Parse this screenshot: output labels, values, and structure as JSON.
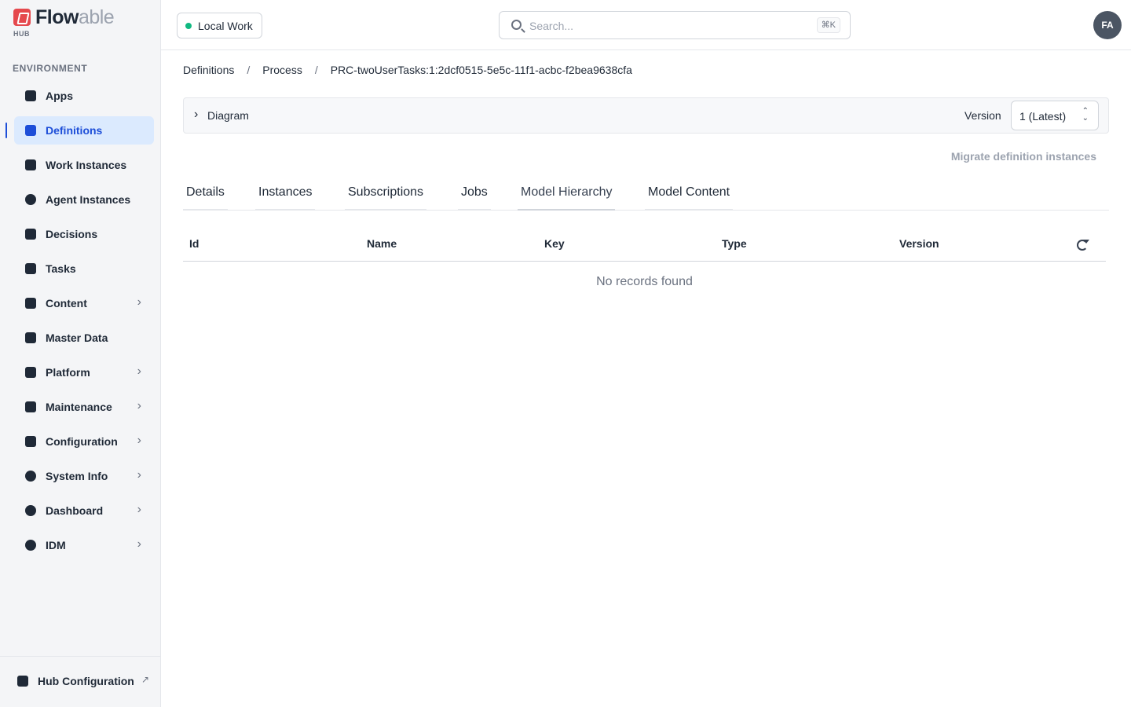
{
  "brand": {
    "name_bold": "Flow",
    "name_light": "able",
    "sub": "HUB"
  },
  "sidebar": {
    "section_label": "ENVIRONMENT",
    "items": [
      {
        "label": "Apps",
        "icon": "apps-icon",
        "chevron": false,
        "active": false
      },
      {
        "label": "Definitions",
        "icon": "definitions-icon",
        "chevron": false,
        "active": true
      },
      {
        "label": "Work Instances",
        "icon": "inbox-icon",
        "chevron": false,
        "active": false
      },
      {
        "label": "Agent Instances",
        "icon": "agent-icon",
        "chevron": false,
        "active": false
      },
      {
        "label": "Decisions",
        "icon": "table-icon",
        "chevron": false,
        "active": false
      },
      {
        "label": "Tasks",
        "icon": "clipboard-check-icon",
        "chevron": false,
        "active": false
      },
      {
        "label": "Content",
        "icon": "file-icon",
        "chevron": true,
        "active": false
      },
      {
        "label": "Master Data",
        "icon": "file-lock-icon",
        "chevron": false,
        "active": false
      },
      {
        "label": "Platform",
        "icon": "cube-icon",
        "chevron": true,
        "active": false
      },
      {
        "label": "Maintenance",
        "icon": "tools-icon",
        "chevron": true,
        "active": false
      },
      {
        "label": "Configuration",
        "icon": "key-icon",
        "chevron": true,
        "active": false
      },
      {
        "label": "System Info",
        "icon": "globe-icon",
        "chevron": true,
        "active": false
      },
      {
        "label": "Dashboard",
        "icon": "pie-chart-icon",
        "chevron": true,
        "active": false
      },
      {
        "label": "IDM",
        "icon": "users-icon",
        "chevron": true,
        "active": false
      }
    ],
    "footer": {
      "label": "Hub Configuration",
      "ext": "↗"
    }
  },
  "topbar": {
    "environment": "Local Work",
    "environment_status_color": "#10b981",
    "search_placeholder": "Search...",
    "shortcut": "⌘K",
    "avatar_initials": "FA"
  },
  "breadcrumb": {
    "items": [
      "Definitions",
      "Process",
      "PRC-twoUserTasks:1:2dcf0515-5e5c-11f1-acbc-f2bea9638cfa"
    ],
    "separator": "/"
  },
  "diagram": {
    "label": "Diagram",
    "version_label": "Version",
    "version_value": "1 (Latest)"
  },
  "migrate_label": "Migrate definition instances",
  "tabs": [
    {
      "label": "Details",
      "active": false
    },
    {
      "label": "Instances",
      "active": false
    },
    {
      "label": "Subscriptions",
      "active": false
    },
    {
      "label": "Jobs",
      "active": false
    },
    {
      "label": "Model Hierarchy",
      "active": true
    },
    {
      "label": "Model Content",
      "active": false
    }
  ],
  "table": {
    "columns": [
      "Id",
      "Name",
      "Key",
      "Type",
      "Version"
    ],
    "empty_text": "No records found"
  },
  "colors": {
    "accent": "#1d4ed8",
    "brand": "#e5484d"
  }
}
